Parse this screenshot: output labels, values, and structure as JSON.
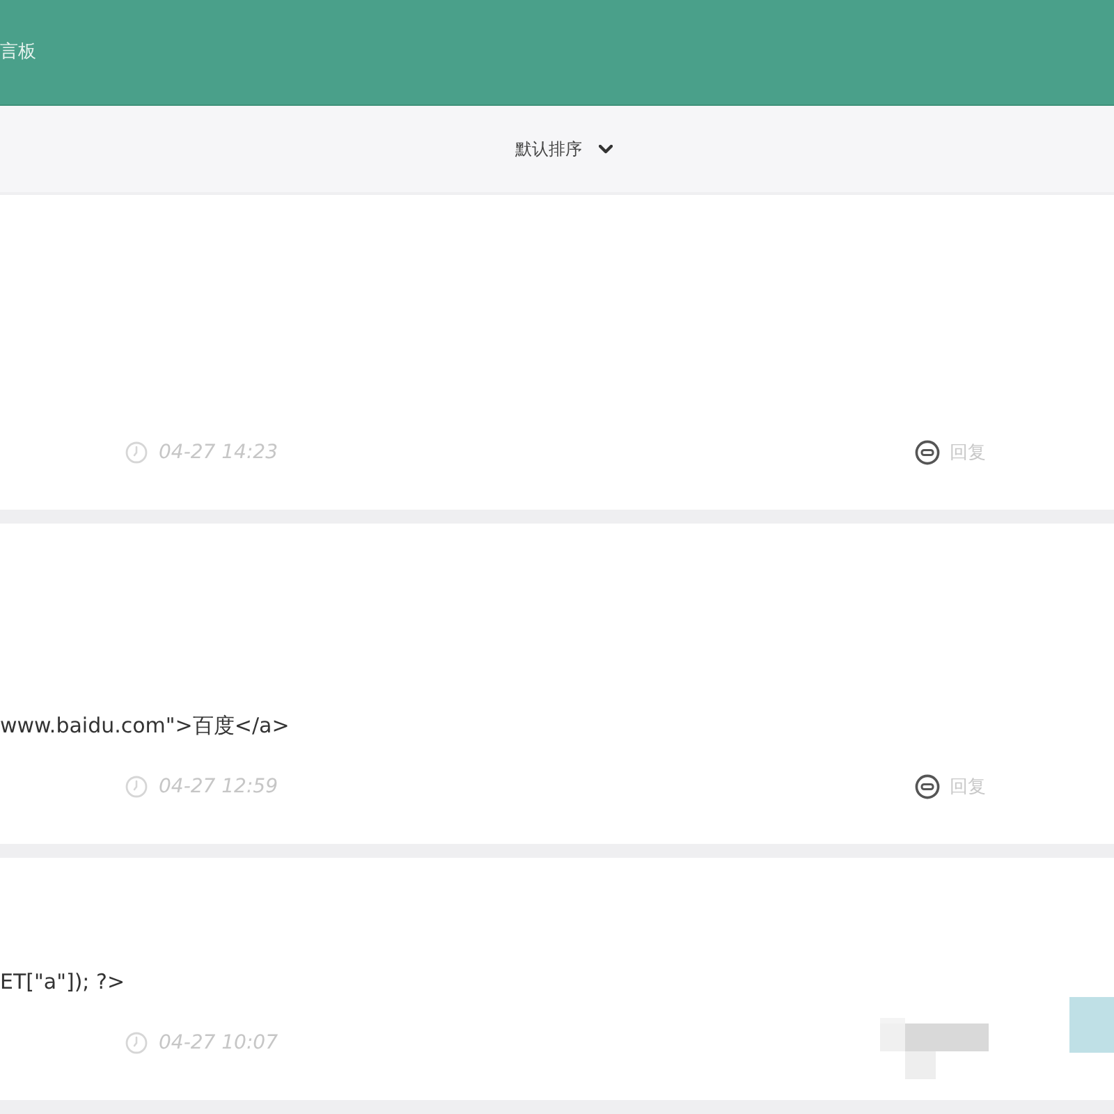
{
  "header": {
    "title": "言板"
  },
  "sort": {
    "label": "默认排序"
  },
  "messages": [
    {
      "time": "04-27 14:23",
      "reply": "回复"
    },
    {
      "content": "www.baidu.com\">百度</a>",
      "time": "04-27 12:59",
      "reply": "回复"
    },
    {
      "content": "ET[\"a\"]); ?>",
      "time": "04-27 10:07"
    }
  ]
}
